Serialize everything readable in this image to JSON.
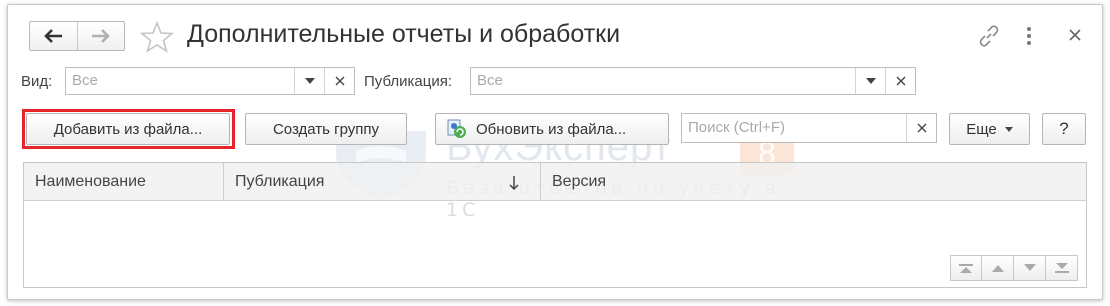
{
  "window": {
    "title": "Дополнительные отчеты и обработки"
  },
  "filters": {
    "vid_label": "Вид:",
    "vid_value": "Все",
    "publication_label": "Публикация:",
    "publication_value": "Все"
  },
  "toolbar": {
    "add_from_file": "Добавить из файла...",
    "create_group": "Создать группу",
    "update_from_file": "Обновить из файла...",
    "search_placeholder": "Поиск (Ctrl+F)",
    "more": "Еще",
    "help": "?"
  },
  "table": {
    "columns": [
      "Наименование",
      "Публикация",
      "Версия"
    ],
    "sort_column": "Публикация",
    "rows": []
  },
  "watermark": {
    "name": "БухЭксперт",
    "badge": "8",
    "subtitle": "База ответов по учёту в 1С"
  },
  "icons": {
    "back": "arrow-left-icon",
    "forward": "arrow-right-icon",
    "favorite": "star-icon",
    "link": "link-icon",
    "menu": "more-vertical-icon",
    "close": "close-icon",
    "update": "update-from-file-icon",
    "sort": "sort-down-icon"
  },
  "colors": {
    "highlight": "#e8242b",
    "text": "#333333",
    "border": "#bdbdbd"
  }
}
